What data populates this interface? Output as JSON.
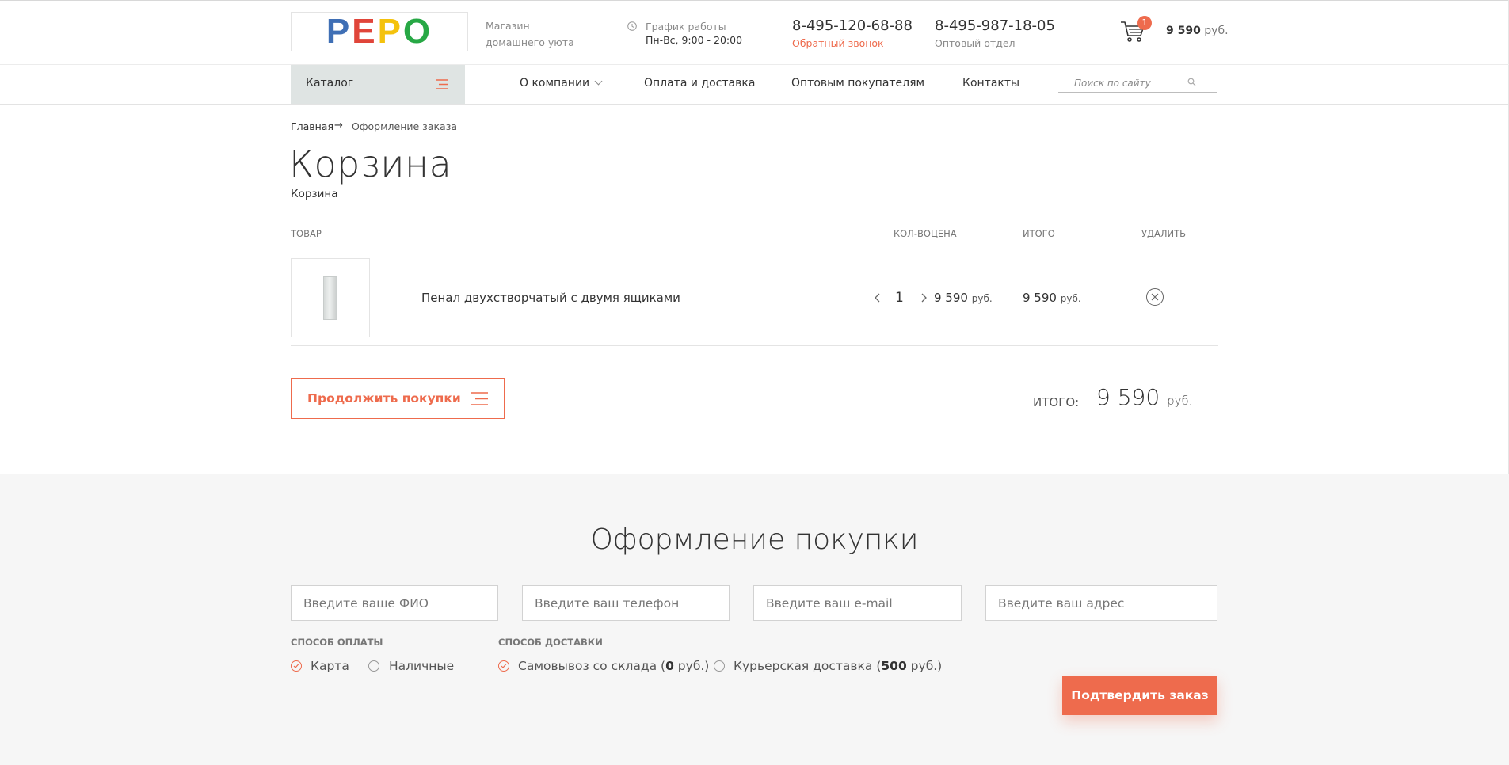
{
  "header": {
    "logo_letters": [
      {
        "ch": "P",
        "color": "#3f6fb5"
      },
      {
        "ch": "E",
        "color": "#e0453a"
      },
      {
        "ch": "P",
        "color": "#f4c20d"
      },
      {
        "ch": "O",
        "color": "#27a845"
      }
    ],
    "tagline_line1": "Магазин",
    "tagline_line2": "домашнего уюта",
    "hours_label": "График работы",
    "hours_value": "Пн-Вс, 9:00 - 20:00",
    "phone1": "8-495-120-68-88",
    "callback_link": "Обратный звонок",
    "phone2": "8-495-987-18-05",
    "wholesale_label": "Оптовый отдел",
    "cart_count": "1",
    "cart_total_amount": "9 590",
    "cart_total_currency": "руб."
  },
  "nav": {
    "catalog": "Каталог",
    "items": [
      "О компании",
      "Оплата и доставка",
      "Оптовым покупателям",
      "Контакты"
    ],
    "search_placeholder": "Поиск по сайту"
  },
  "breadcrumb": {
    "home": "Главная",
    "arrow": "→",
    "current": "Оформление заказа"
  },
  "page": {
    "title": "Корзина",
    "subtitle": "Корзина"
  },
  "cart": {
    "columns": {
      "product": "Товар",
      "qty_price": "Кол-воцена",
      "total": "Итого",
      "remove": "Удалить"
    },
    "items": [
      {
        "name": "Пенал двухстворчатый с двумя ящиками",
        "qty": "1",
        "price": "9 590",
        "total": "9 590",
        "currency": "руб."
      }
    ],
    "continue_label": "Продолжить покупки",
    "total_label": "Итого:",
    "total_value": "9 590",
    "total_currency": "руб."
  },
  "checkout": {
    "title": "Оформление покупки",
    "placeholders": {
      "name": "Введите ваше ФИО",
      "phone": "Введите ваш телефон",
      "email": "Введите ваш e-mail",
      "address": "Введите ваш адрес"
    },
    "payment_label": "Способ оплаты",
    "payment_options": [
      "Карта",
      "Наличные"
    ],
    "payment_selected": "Карта",
    "delivery_label": "Способ доставки",
    "delivery_options": [
      {
        "text_before": "Самовывоз со склада (",
        "amount": "0",
        "text_after": " руб.)"
      },
      {
        "text_before": "Курьерская доставка (",
        "amount": "500",
        "text_after": " руб.)"
      }
    ],
    "delivery_selected": "Самовывоз со склада",
    "confirm_label": "Подтвердить заказ"
  },
  "colors": {
    "accent": "#ee6b4d",
    "catalog_bg": "#dfe4e3",
    "checkout_bg": "#f6f6f6"
  }
}
